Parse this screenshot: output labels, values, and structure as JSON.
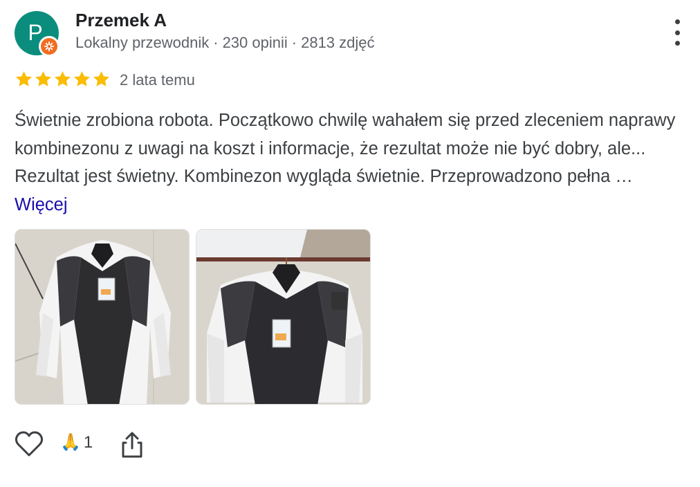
{
  "author": {
    "avatar_letter": "P",
    "name": "Przemek A",
    "role": "Lokalny przewodnik",
    "reviews": "230 opinii",
    "photos": "2813 zdjęć",
    "separator": "·"
  },
  "review": {
    "rating": 5,
    "date": "2 lata temu",
    "text": "Świetnie zrobiona robota. Początkowo chwilę wahałem się przed zleceniem naprawy kombinezonu z uwagi na koszt i informacje, że rezultat może nie być dobry, ale... Rezultat jest świetny. Kombinezon wygląda świetnie. Przeprowadzono pełna …",
    "more_label": "Więcej"
  },
  "photos": [
    {
      "alt": "Kombinezon motocyklowy"
    },
    {
      "alt": "Kombinezon motocyklowy"
    }
  ],
  "reactions": {
    "emoji": "🙏",
    "count": "1"
  },
  "colors": {
    "avatar_bg": "#0b8d7e",
    "badge": "#f16d22",
    "star": "#fbbc04",
    "link": "#1a0dab",
    "meta_text": "#5f6368"
  },
  "icons": [
    "more-vert-icon",
    "star-icon",
    "heart-outline-icon",
    "share-icon",
    "local-guide-badge-icon"
  ]
}
